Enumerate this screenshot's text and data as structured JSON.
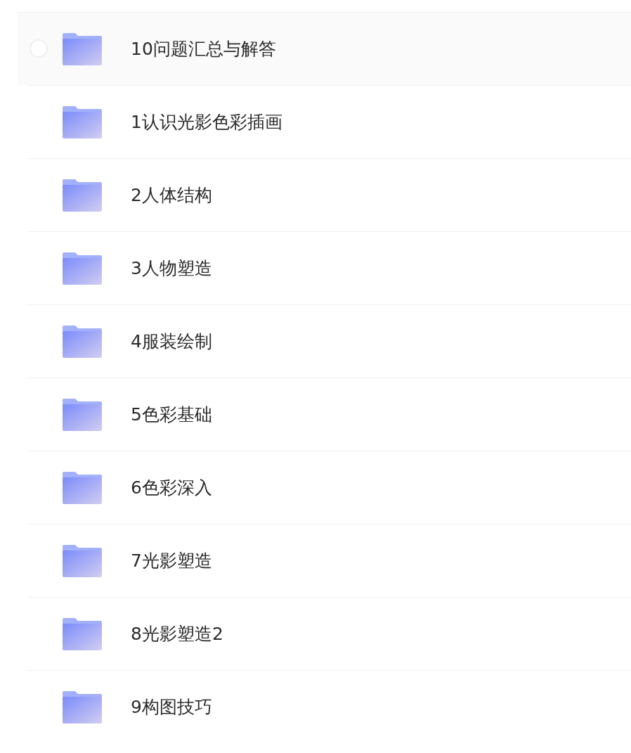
{
  "folders": [
    {
      "name": "10问题汇总与解答",
      "hovered": true
    },
    {
      "name": "1认识光影色彩插画",
      "hovered": false
    },
    {
      "name": "2人体结构",
      "hovered": false
    },
    {
      "name": "3人物塑造",
      "hovered": false
    },
    {
      "name": "4服装绘制",
      "hovered": false
    },
    {
      "name": "5色彩基础",
      "hovered": false
    },
    {
      "name": "6色彩深入",
      "hovered": false
    },
    {
      "name": "7光影塑造",
      "hovered": false
    },
    {
      "name": "8光影塑造2",
      "hovered": false
    },
    {
      "name": "9构图技巧",
      "hovered": false
    }
  ]
}
